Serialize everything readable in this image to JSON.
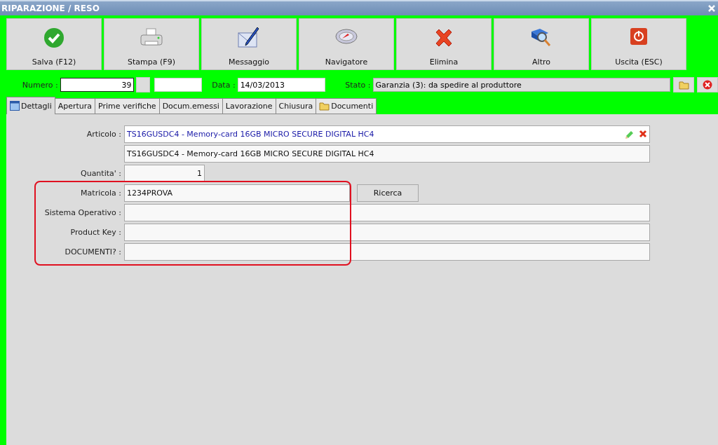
{
  "window": {
    "title": "RIPARAZIONE / RESO"
  },
  "toolbar": [
    {
      "label": "Salva (F12)",
      "kind": "check"
    },
    {
      "label": "Stampa (F9)",
      "kind": "printer"
    },
    {
      "label": "Messaggio",
      "kind": "envelope"
    },
    {
      "label": "Navigatore",
      "kind": "compass"
    },
    {
      "label": "Elimina",
      "kind": "cross"
    },
    {
      "label": "Altro",
      "kind": "book"
    },
    {
      "label": "Uscita (ESC)",
      "kind": "power"
    }
  ],
  "header": {
    "numero_label": "Numero :",
    "numero": "39",
    "data_label": "Data :",
    "data": "14/03/2013",
    "stato_label": "Stato :",
    "stato": "Garanzia (3): da spedire al produttore"
  },
  "tabs": [
    {
      "label": "Dettagli",
      "selected": true,
      "kind": "calendar"
    },
    {
      "label": "Apertura",
      "selected": false
    },
    {
      "label": "Prime verifiche",
      "selected": false
    },
    {
      "label": "Docum.emessi",
      "selected": false
    },
    {
      "label": "Lavorazione",
      "selected": false
    },
    {
      "label": "Chiusura",
      "selected": false
    },
    {
      "label": "Documenti",
      "selected": false,
      "kind": "folder"
    }
  ],
  "form": [
    {
      "label": "Articolo :",
      "value": "TS16GUSDC4 - Memory-card 16GB MICRO SECURE DIGITAL HC4",
      "kind": "article"
    },
    {
      "value": "TS16GUSDC4 - Memory-card 16GB MICRO SECURE DIGITAL HC4",
      "kind": "description"
    },
    {
      "label": "Quantita' :",
      "value": "1",
      "kind": "quantity"
    },
    {
      "label": "Matricola :",
      "value": "1234PROVA",
      "kind": "serial",
      "button": "Ricerca",
      "highlighted": true
    },
    {
      "label": "Sistema Operativo :",
      "kind": "text",
      "highlighted": true
    },
    {
      "label": "Product Key :",
      "kind": "text",
      "highlighted": true
    },
    {
      "label": "DOCUMENTI? :",
      "kind": "text",
      "highlighted": true
    }
  ]
}
